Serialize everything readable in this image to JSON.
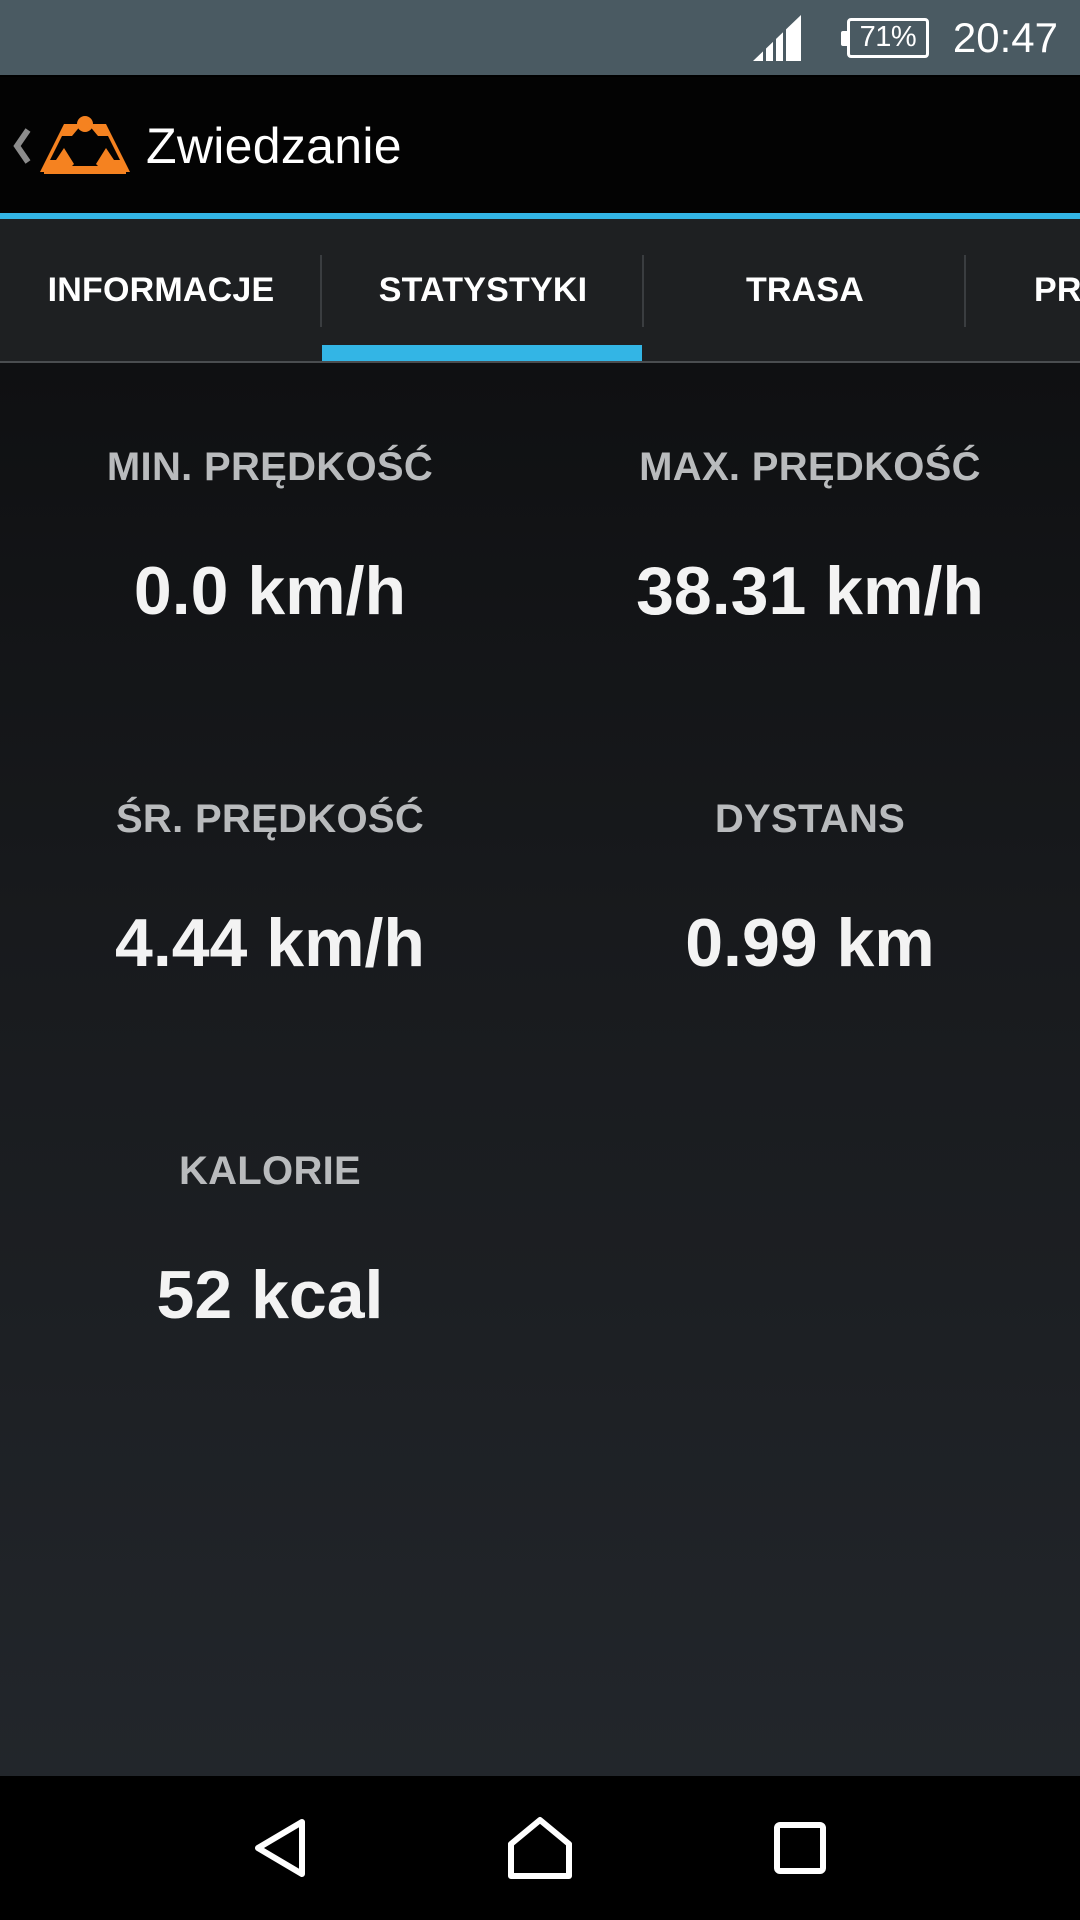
{
  "status_bar": {
    "battery_percent": "71%",
    "time": "20:47",
    "icons": [
      "signal-icon",
      "battery-icon"
    ]
  },
  "action_bar": {
    "title": "Zwiedzanie",
    "icons": [
      "back-chevron-icon",
      "app-logo-icon"
    ],
    "accent_color": "#33b5e5",
    "logo_color": "#f58220"
  },
  "tabs": [
    {
      "label": "INFORMACJE",
      "selected": false
    },
    {
      "label": "STATYSTYKI",
      "selected": true
    },
    {
      "label": "TRASA",
      "selected": false
    },
    {
      "label": "PR",
      "selected": false
    }
  ],
  "stats": [
    {
      "label": "MIN. PRĘDKOŚĆ",
      "value": "0.0 km/h"
    },
    {
      "label": "MAX. PRĘDKOŚĆ",
      "value": "38.31 km/h"
    },
    {
      "label": "ŚR. PRĘDKOŚĆ",
      "value": "4.44 km/h"
    },
    {
      "label": "DYSTANS",
      "value": "0.99 km"
    },
    {
      "label": "KALORIE",
      "value": "52 kcal"
    }
  ],
  "nav_bar": {
    "icons": [
      "back-icon",
      "home-icon",
      "recents-icon"
    ]
  }
}
